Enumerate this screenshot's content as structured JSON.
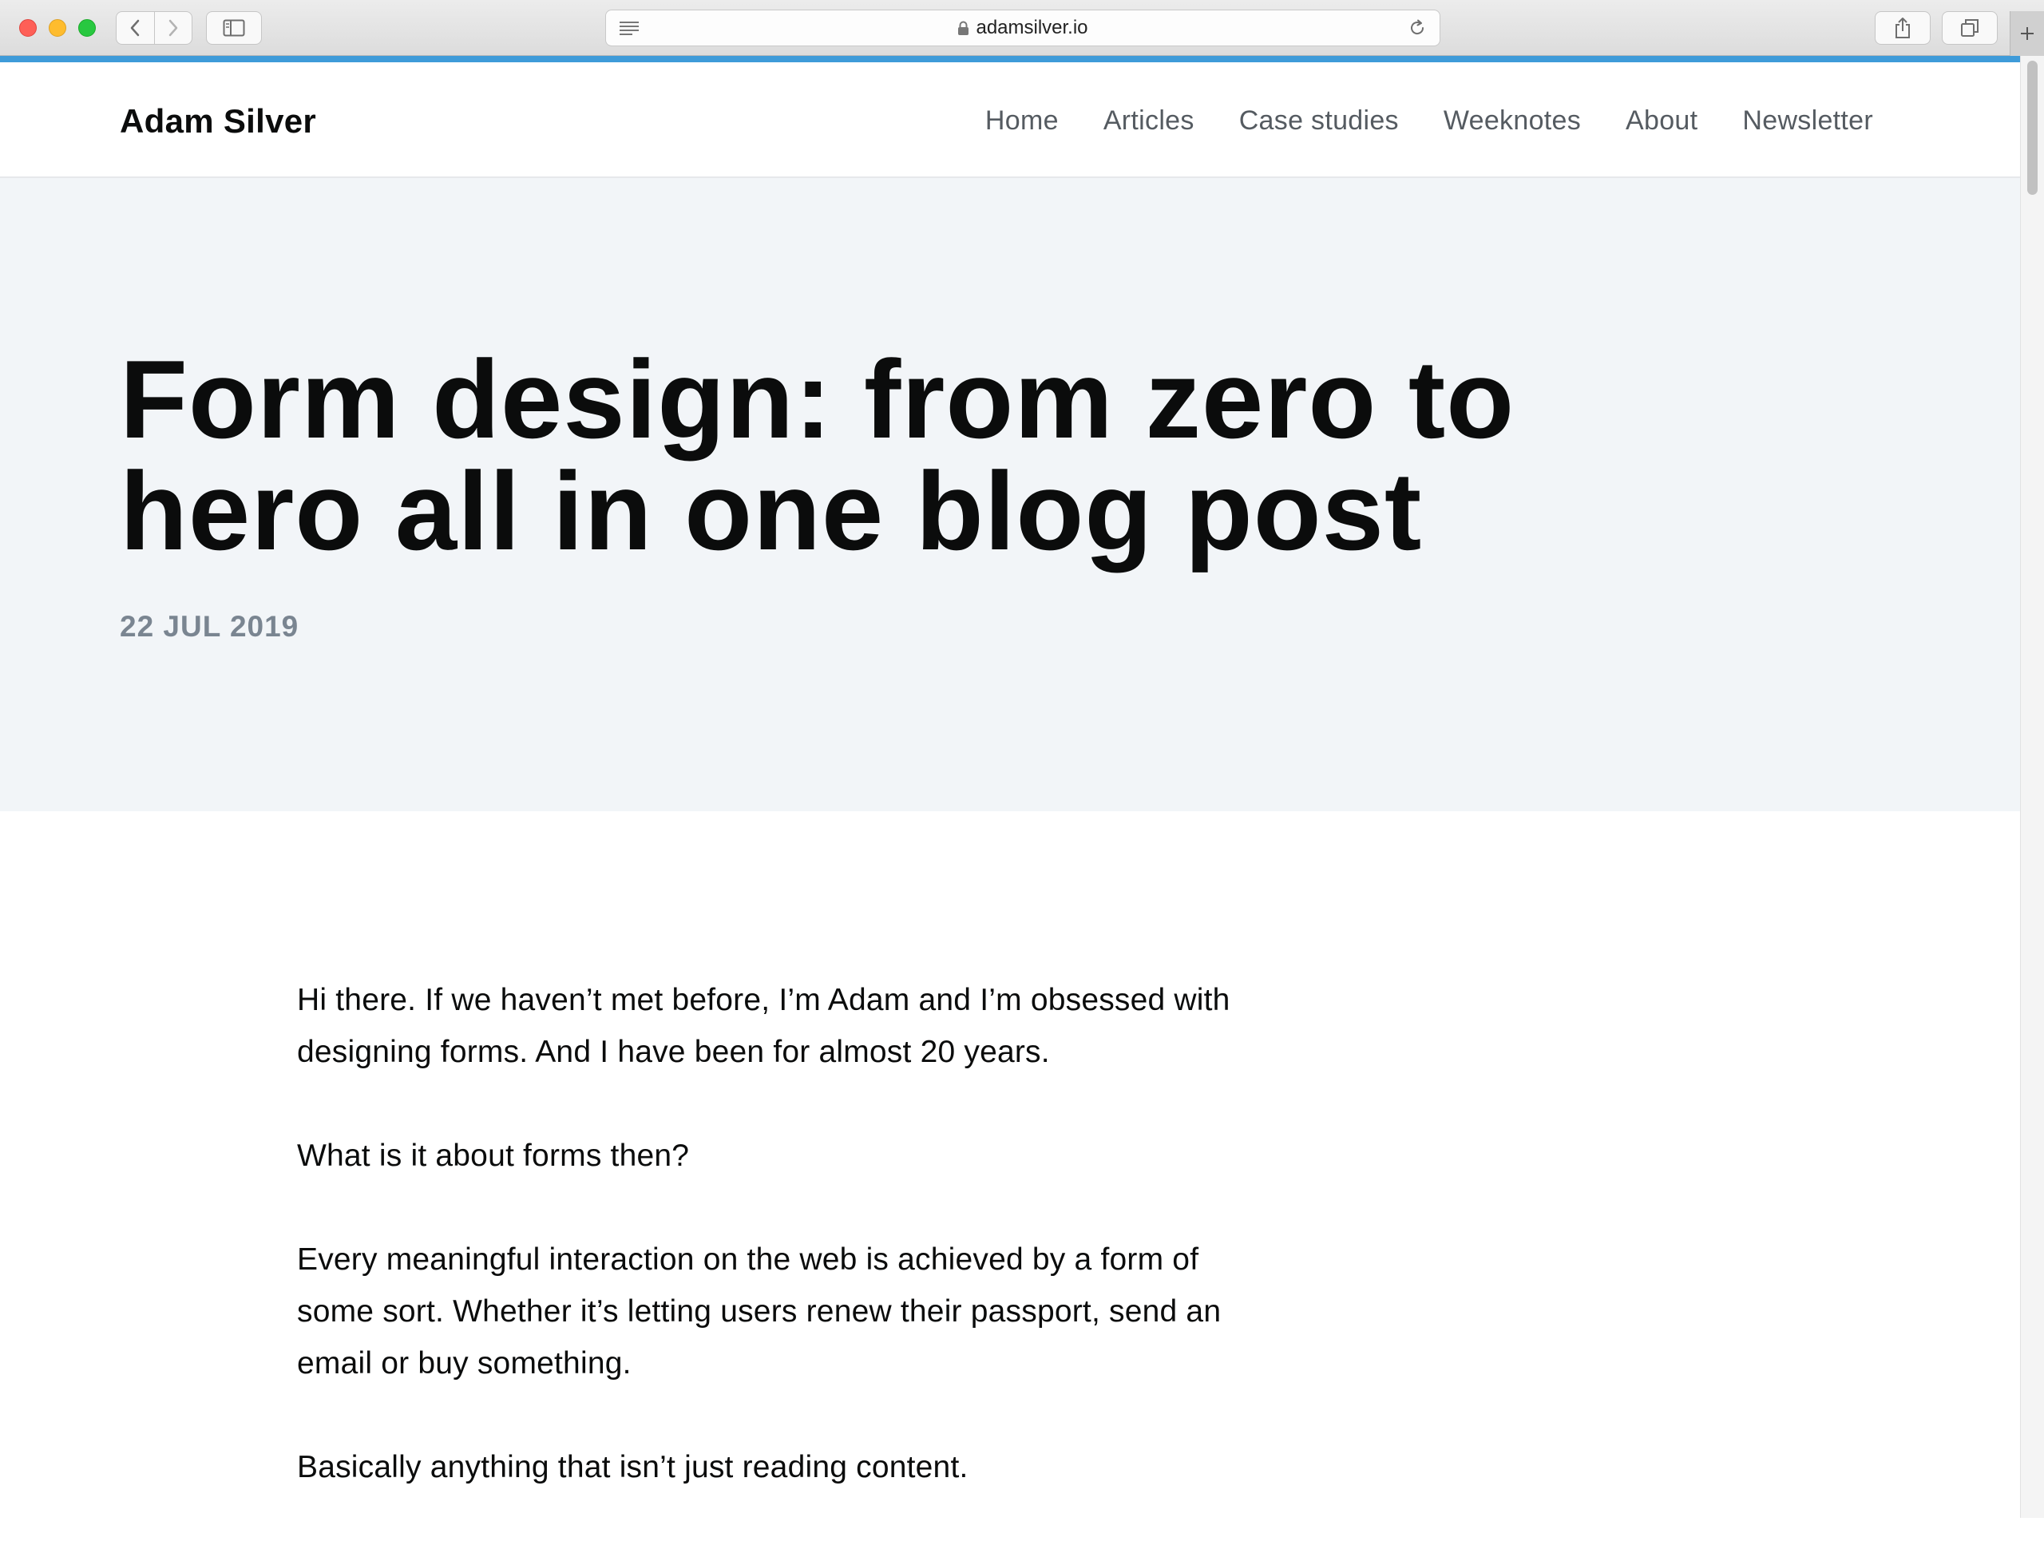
{
  "browser": {
    "url": "adamsilver.io"
  },
  "site": {
    "logo": "Adam Silver",
    "nav": [
      "Home",
      "Articles",
      "Case studies",
      "Weeknotes",
      "About",
      "Newsletter"
    ]
  },
  "hero": {
    "title": "Form design: from zero to hero all in one blog post",
    "date": "22 JUL 2019"
  },
  "article": {
    "paragraphs": [
      "Hi there. If we haven’t met before, I’m Adam and I’m obsessed with designing forms. And I have been for almost 20 years.",
      "What is it about forms then?",
      "Every meaningful interaction on the web is achieved by a form of some sort. Whether it’s letting users renew their passport, send an email or buy something.",
      "Basically anything that isn’t just reading content."
    ]
  }
}
